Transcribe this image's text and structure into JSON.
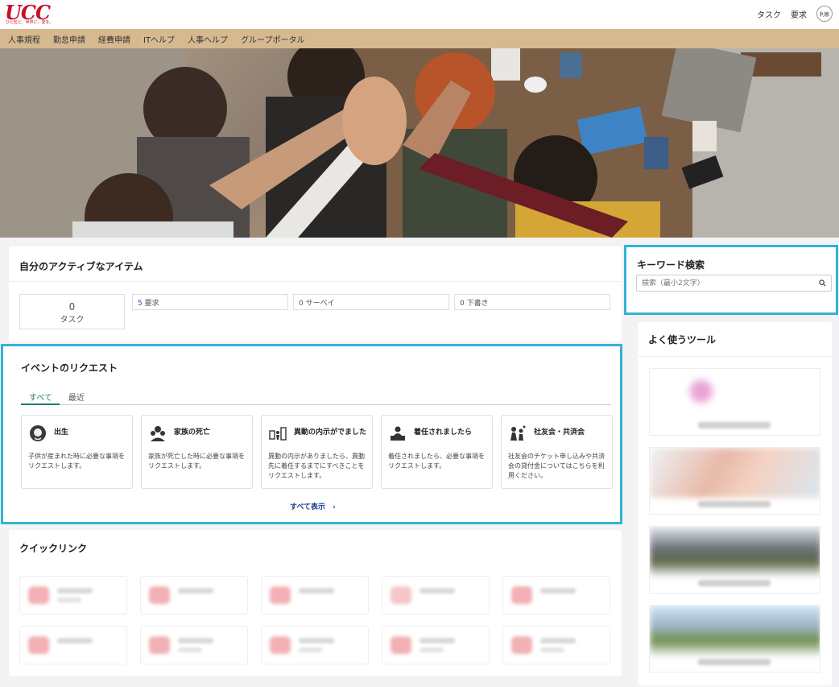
{
  "header": {
    "logo_text": "UCC",
    "logo_tagline": "ひと粒と、世界に、愛を。",
    "links": [
      "タスク",
      "要求"
    ],
    "avatar_label": "利恵"
  },
  "nav": {
    "items": [
      "人事規程",
      "勤怠申請",
      "経費申請",
      "ITヘルプ",
      "人事ヘルプ",
      "グループポータル"
    ]
  },
  "active_items": {
    "title": "自分のアクティブなアイテム",
    "task_count": "0",
    "task_label": "タスク",
    "stats": [
      {
        "count": "5",
        "label": "要求"
      },
      {
        "count": "0",
        "label": "サーベイ"
      },
      {
        "count": "0",
        "label": "下書き"
      }
    ]
  },
  "event_requests": {
    "title": "イベントのリクエスト",
    "tabs": [
      "すべて",
      "最近"
    ],
    "active_tab": "すべて",
    "cards": [
      {
        "title": "出生",
        "desc": "子供が産まれた時に必要な事項をリクエストします。",
        "icon": "baby-icon"
      },
      {
        "title": "家族の死亡",
        "desc": "家族が死亡した時に必要な事項をリクエストします。",
        "icon": "family-icon"
      },
      {
        "title": "異動の内示がでました",
        "desc": "異動の内示がありましたら、異動先に着任するまでにすべきことをリクエストします。",
        "icon": "transfer-icon"
      },
      {
        "title": "着任されましたら",
        "desc": "着任されましたら、必要な事項をリクエストします。",
        "icon": "desk-icon"
      },
      {
        "title": "社友会・共済会",
        "desc": "社友会のチケット申し込みや共済会の貸付金についてはこちらを利用ください。",
        "icon": "people-icon"
      }
    ],
    "show_all_label": "すべて表示"
  },
  "quick_links": {
    "title": "クイックリンク"
  },
  "keyword_search": {
    "title": "キーワード検索",
    "placeholder": "検索（最小2文字）"
  },
  "tools": {
    "title": "よく使うツール"
  },
  "colors": {
    "nav_bg": "#d7b990",
    "brand_red": "#c8102e",
    "highlight": "#34b3d4",
    "link_blue": "#1a3f8f",
    "tab_green": "#1e7a6e"
  }
}
